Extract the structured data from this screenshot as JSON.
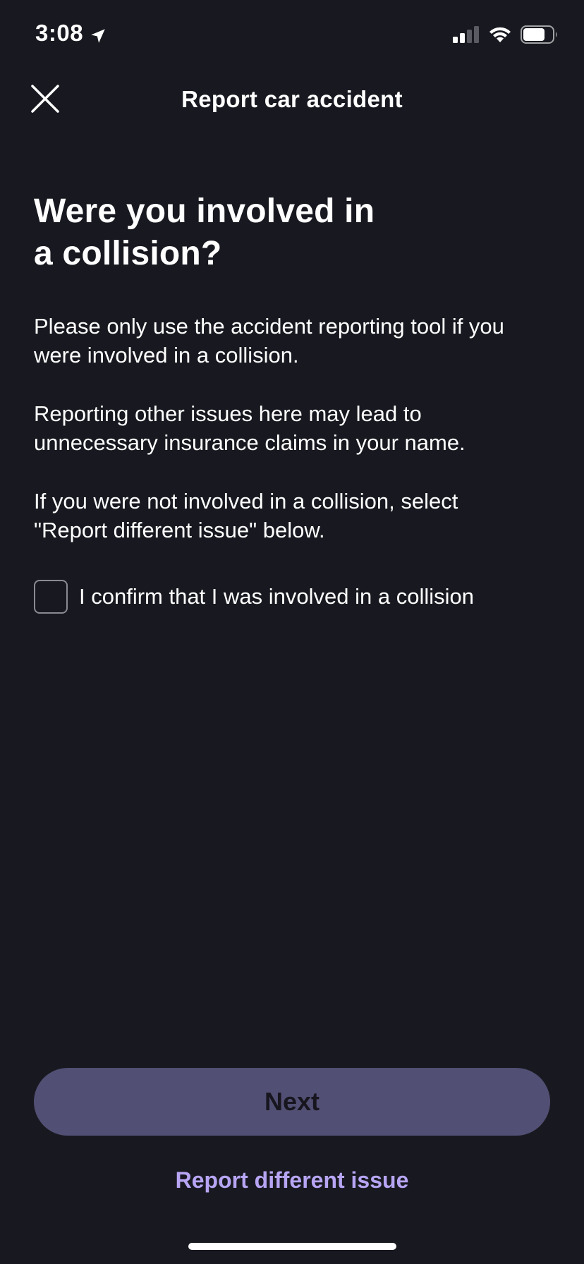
{
  "status_bar": {
    "time": "3:08",
    "location_icon": "location-arrow-icon",
    "signal_icon": "cellular-signal-icon",
    "wifi_icon": "wifi-icon",
    "battery_icon": "battery-icon"
  },
  "header": {
    "close_icon": "close-icon",
    "title": "Report car accident"
  },
  "main": {
    "title": "Were you involved in a collision?",
    "paragraphs": [
      "Please only use the accident reporting tool if you were involved in a collision.",
      "Reporting other issues here may lead to unnecessary insurance claims in your name.",
      "If you were not involved in a collision, select \"Report different issue\" below."
    ],
    "confirm_checkbox": {
      "label": "I confirm that I was involved in a collision",
      "checked": false
    }
  },
  "actions": {
    "next_label": "Next",
    "report_different_label": "Report different issue"
  },
  "colors": {
    "background": "#181920",
    "next_button_disabled": "#524f74",
    "link_accent": "#b7a5f4",
    "text": "#ffffff"
  }
}
